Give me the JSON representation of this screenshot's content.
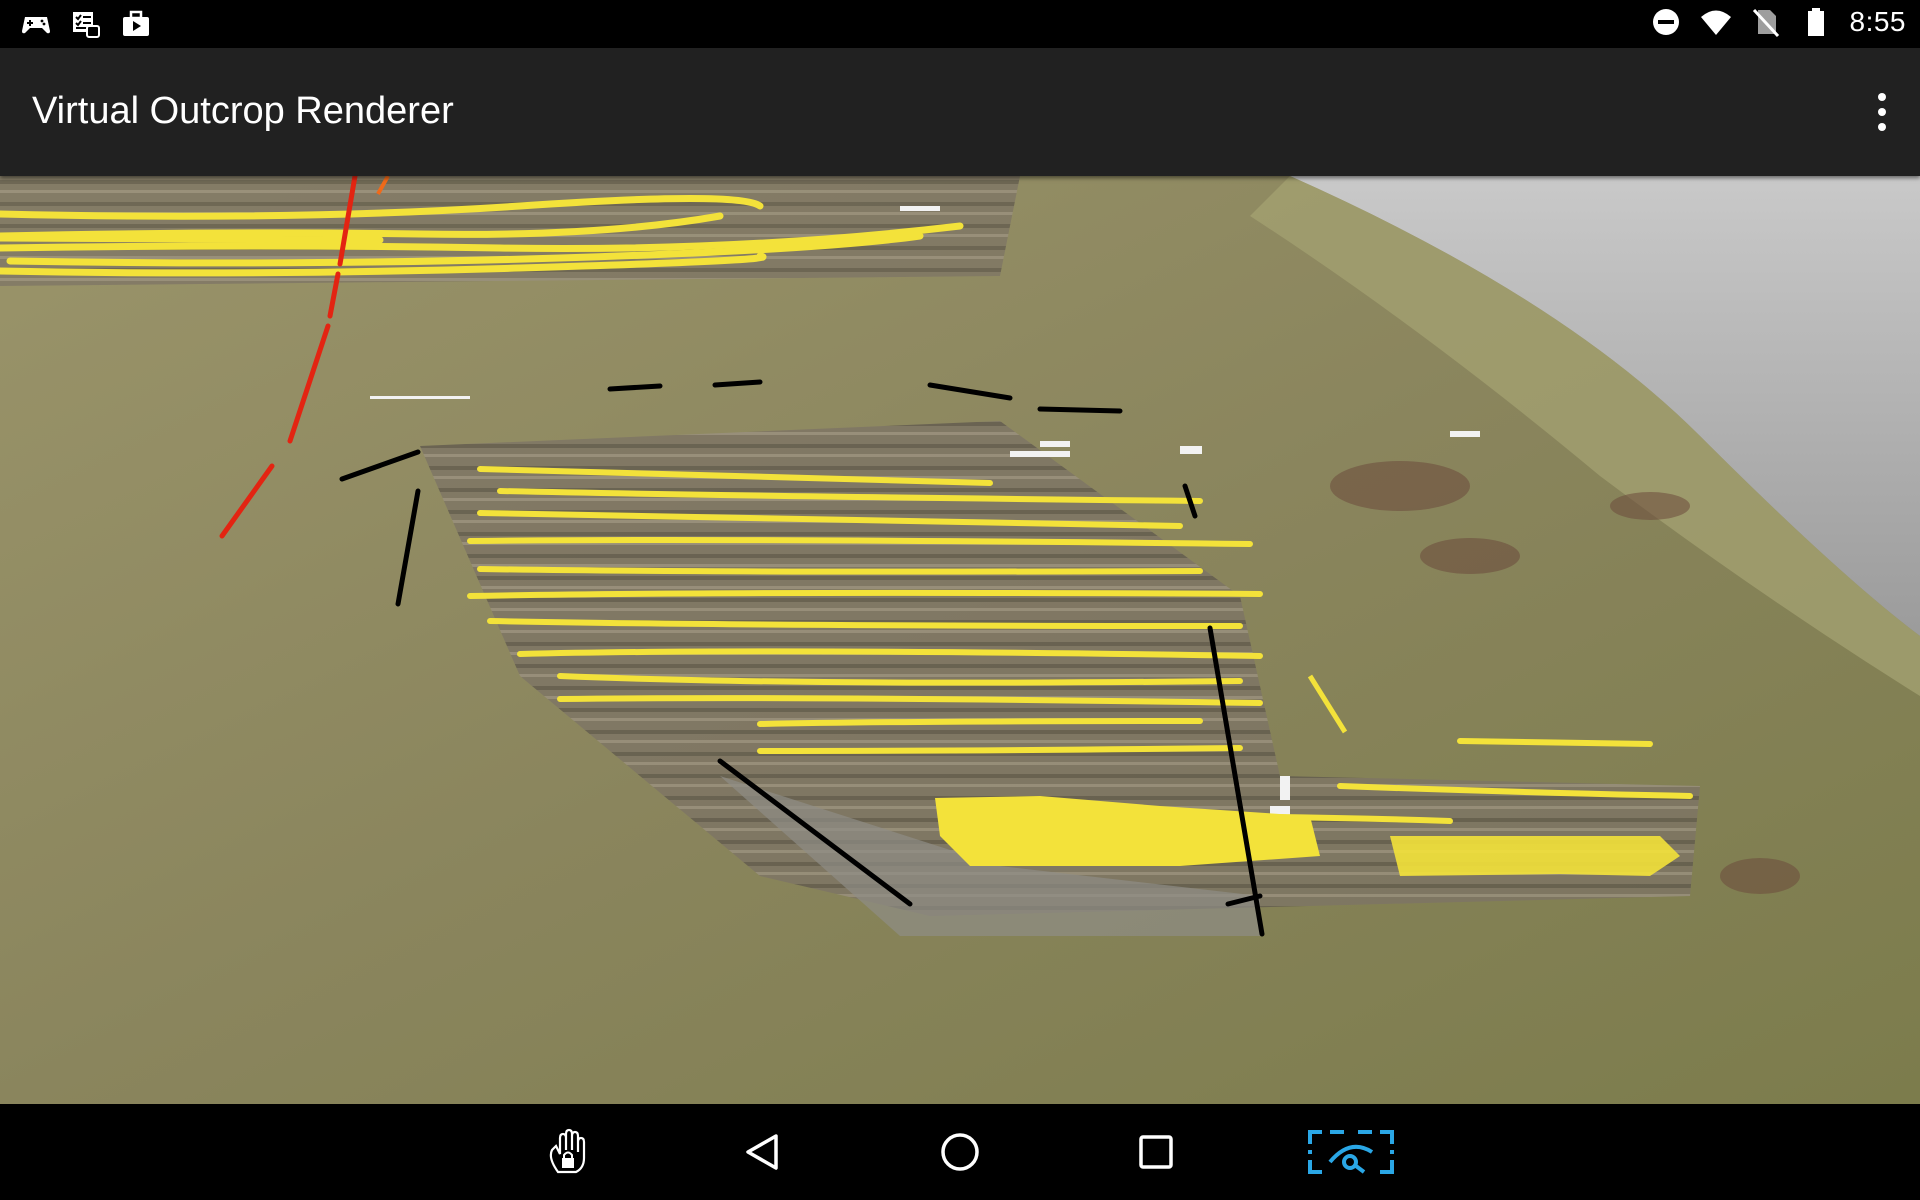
{
  "status_bar": {
    "time": "8:55",
    "left_icons": [
      "game-controller-icon",
      "notes-checklist-icon",
      "briefcase-play-icon"
    ],
    "right_icons": [
      "do-not-disturb-icon",
      "wifi-icon",
      "no-sim-icon",
      "battery-icon"
    ]
  },
  "app_bar": {
    "title": "Virtual Outcrop Renderer",
    "menu_icon": "more-vert-icon"
  },
  "viewport": {
    "description_icon": "3d-outcrop-model",
    "colors": {
      "bedding_traces": "#f3e23a",
      "fault_trace": "#e32412",
      "interpretation_lines": "#000000",
      "grass": "#8e8c58",
      "rock": "#857a66"
    }
  },
  "nav_bar": {
    "buttons": [
      "touch-lock-icon",
      "back-icon",
      "home-icon",
      "recents-icon",
      "screen-capture-icon"
    ],
    "accent": "#2aa7e6"
  }
}
